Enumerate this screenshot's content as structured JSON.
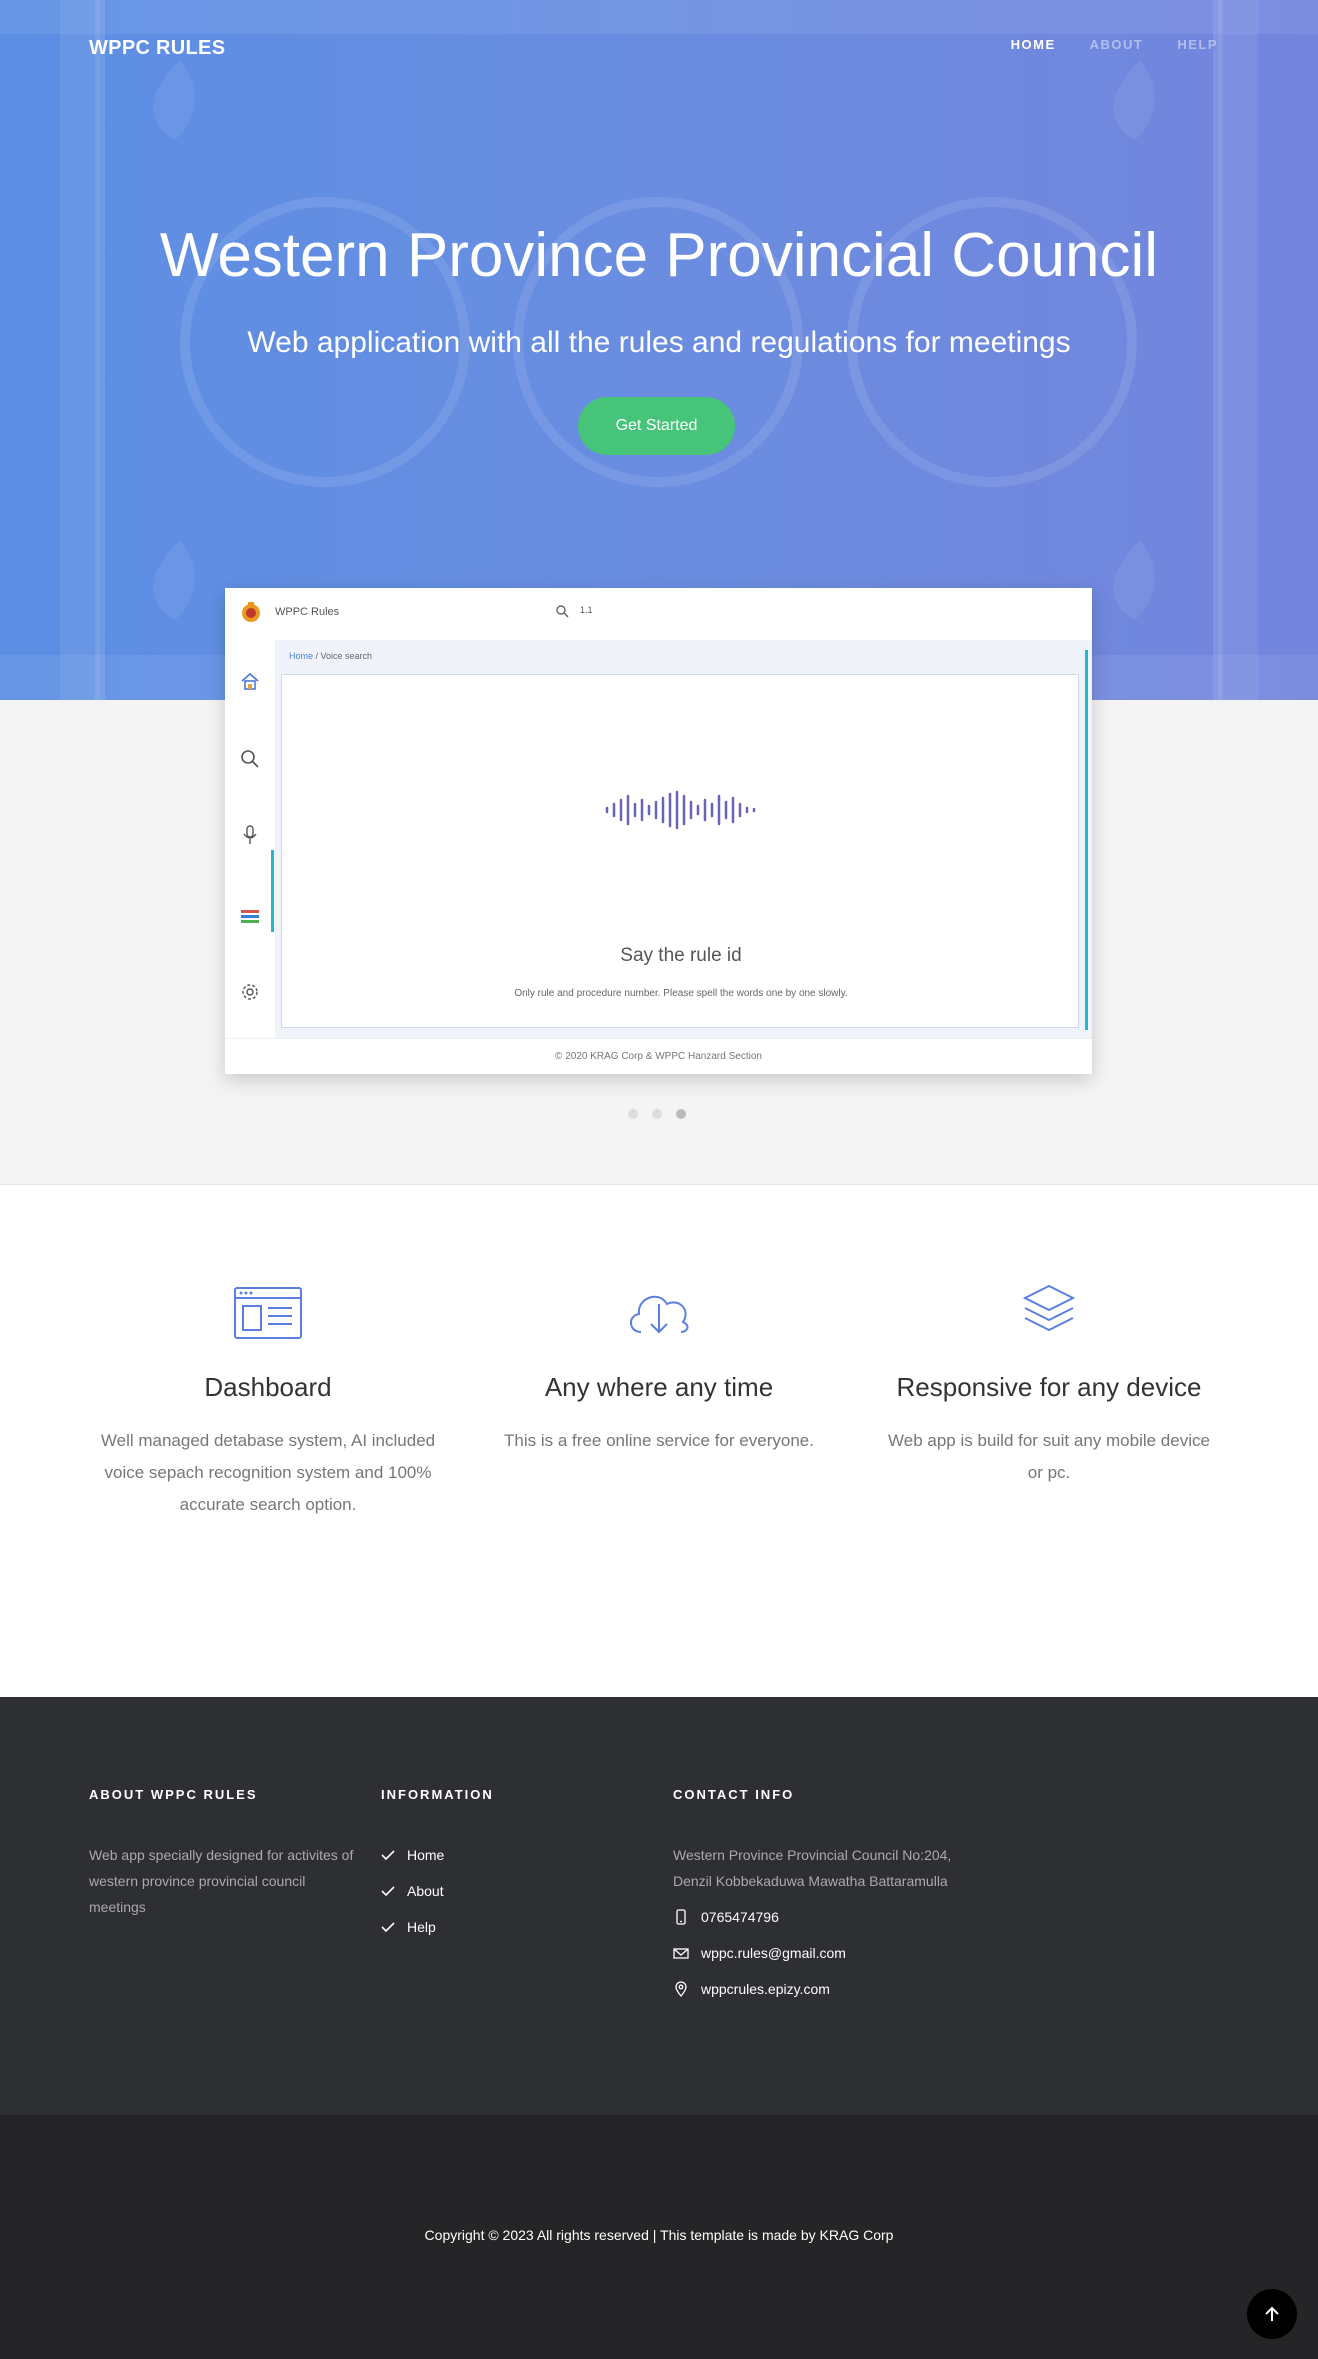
{
  "header": {
    "brand": "WPPC RULES",
    "nav": [
      {
        "label": "HOME",
        "active": true
      },
      {
        "label": "ABOUT",
        "active": false
      },
      {
        "label": "HELP",
        "active": false
      }
    ]
  },
  "hero": {
    "title": "Western Province Provincial Council",
    "subtitle": "Web application with all the rules and regulations for meetings",
    "cta_label": "Get Started"
  },
  "preview": {
    "app_name": "WPPC Rules",
    "search_query": "1.1",
    "breadcrumb_home": "Home",
    "breadcrumb_current": "/ Voice search",
    "prompt": "Say the rule id",
    "hint": "Only rule and procedure number. Please spell the words one by one slowly.",
    "footer": "©  2020  KRAG Corp & WPPC Hanzard Section",
    "sidebar_icons": [
      "home-icon",
      "search-icon",
      "microphone-icon",
      "books-icon",
      "gear-icon"
    ],
    "active_sidebar": "microphone-icon"
  },
  "carousel": {
    "slide_count": 3,
    "active_index": 2
  },
  "features": [
    {
      "icon": "dashboard-icon",
      "title": "Dashboard",
      "text": "Well managed detabase system, AI included voice sepach recognition system and 100% accurate search option."
    },
    {
      "icon": "cloud-download-icon",
      "title": "Any where any time",
      "text": "This is a free online service for everyone."
    },
    {
      "icon": "layers-icon",
      "title": "Responsive for any device",
      "text": "Web app is build for suit any mobile device or pc."
    }
  ],
  "footer": {
    "about_heading": "ABOUT WPPC RULES",
    "about_text": "Web app specially designed for activites of western province provincial council meetings",
    "info_heading": "INFORMATION",
    "info_links": [
      "Home",
      "About",
      "Help"
    ],
    "contact_heading": "CONTACT INFO",
    "address": "Western Province Provincial Council No:204, Denzil Kobbekaduwa Mawatha Battaramulla",
    "phone": "0765474796",
    "email": "wppc.rules@gmail.com",
    "website": "wppcrules.epizy.com"
  },
  "copyright": "Copyright © 2023 All rights reserved | This template is made by KRAG Corp",
  "colors": {
    "accent": "#45c47a",
    "hero_start": "#5b8fe4",
    "hero_end": "#7385dd",
    "icon_blue": "#5b7fe0",
    "footer_bg": "#2e2f32"
  }
}
